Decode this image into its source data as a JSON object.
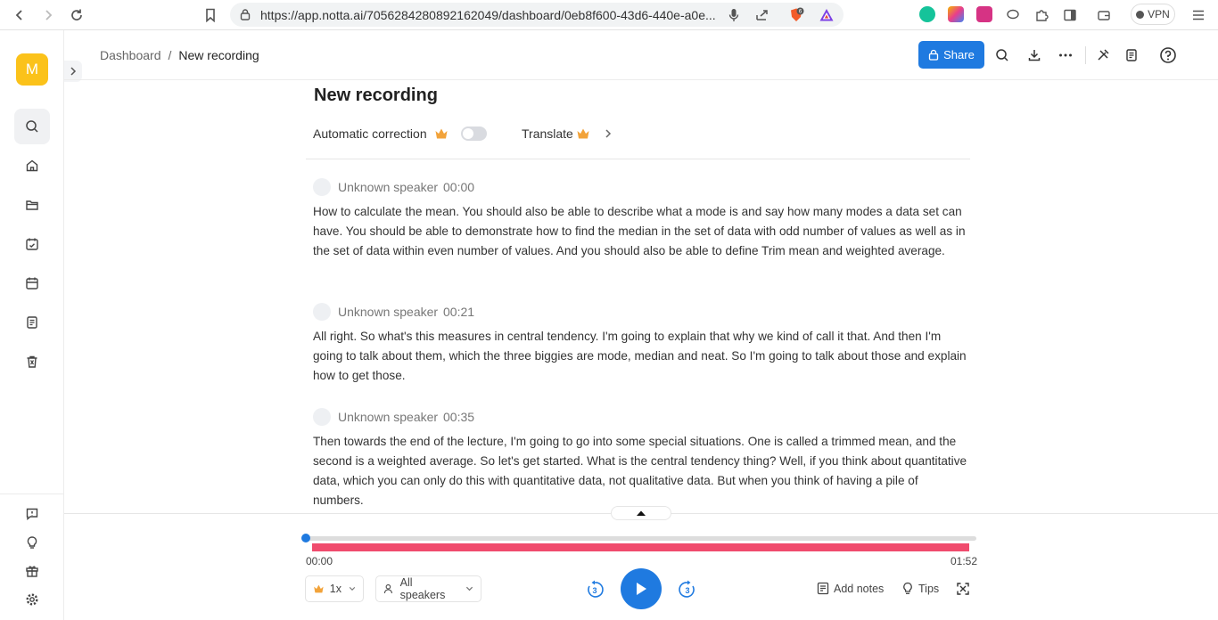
{
  "browser": {
    "url": "https://app.notta.ai/7056284280892162049/dashboard/0eb8f600-43d6-440e-a0e...",
    "shield_count": "6",
    "vpn_label": "VPN"
  },
  "sidebar": {
    "avatar_letter": "M"
  },
  "header": {
    "breadcrumb_root": "Dashboard",
    "breadcrumb_sep": "/",
    "breadcrumb_current": "New recording",
    "share_label": "Share"
  },
  "doc": {
    "title": "New recording",
    "auto_correction_label": "Automatic correction",
    "auto_correction_on": false,
    "translate_label": "Translate"
  },
  "transcript": [
    {
      "speaker": "Unknown speaker",
      "time": "00:00",
      "text": "How to calculate the mean. You should also be able to describe what a mode is and say how many modes a data set can have. You should be able to demonstrate how to find the median in the set of data with odd number of values as well as in the set of data within even number of values. And you should also be able to define Trim mean and weighted average."
    },
    {
      "speaker": "Unknown speaker",
      "time": "00:21",
      "text": "All right. So what's this measures in central tendency. I'm going to explain that why we kind of call it that. And then I'm going to talk about them, which the three biggies are mode, median and neat. So I'm going to talk about those and explain how to get those."
    },
    {
      "speaker": "Unknown speaker",
      "time": "00:35",
      "text": "Then towards the end of the lecture, I'm going to go into some special situations. One is called a trimmed mean, and the second is a weighted average. So let's get started. What is the central tendency thing? Well, if you think about quantitative data, which you can only do this with quantitative data, not qualitative data. But when you think of having a pile of numbers."
    }
  ],
  "player": {
    "current_time": "00:00",
    "duration": "01:52",
    "progress": 0,
    "speed_label": "1x",
    "speakers_label": "All speakers",
    "skip_back_seconds": "3",
    "skip_forward_seconds": "3",
    "add_notes_label": "Add notes",
    "tips_label": "Tips"
  },
  "colors": {
    "accent": "#1f7ae0",
    "waveform": "#f04b6d",
    "avatar": "#fbc21a",
    "crown": "#f2a33a"
  }
}
